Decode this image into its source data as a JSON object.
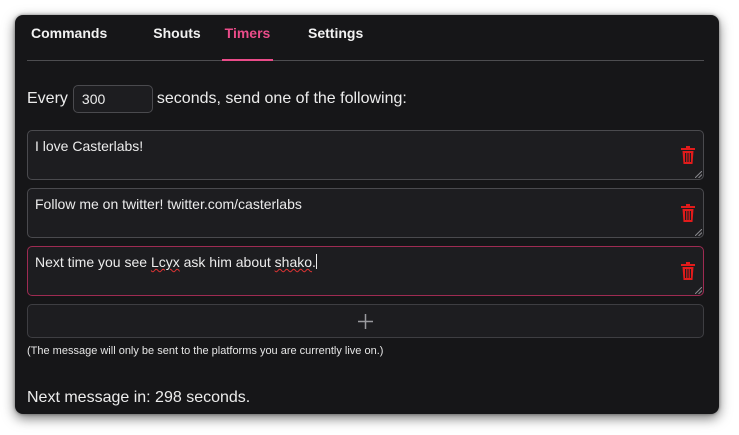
{
  "tabs": [
    {
      "label": "Commands",
      "active": false
    },
    {
      "label": "Shouts",
      "active": false
    },
    {
      "label": "Timers",
      "active": true
    },
    {
      "label": "Settings",
      "active": false
    }
  ],
  "timer": {
    "prefix": "Every",
    "interval_value": "300",
    "suffix": "seconds, send one of the following:"
  },
  "messages": [
    {
      "text": "I love Casterlabs!"
    },
    {
      "text": "Follow me on twitter! twitter.com/casterlabs"
    },
    {
      "text_parts": [
        "Next time you see ",
        "Lcyx",
        " ask him about ",
        "shako",
        "."
      ],
      "focused": true
    }
  ],
  "add_button": {
    "icon": "plus-icon"
  },
  "note": "(The message will only be sent to the platforms you are currently live on.)",
  "next_message": "Next message in: 298 seconds.",
  "colors": {
    "background": "#161618",
    "accent": "#ea4c89",
    "delete": "#e21b1b",
    "focused_border": "#9e2b52"
  }
}
